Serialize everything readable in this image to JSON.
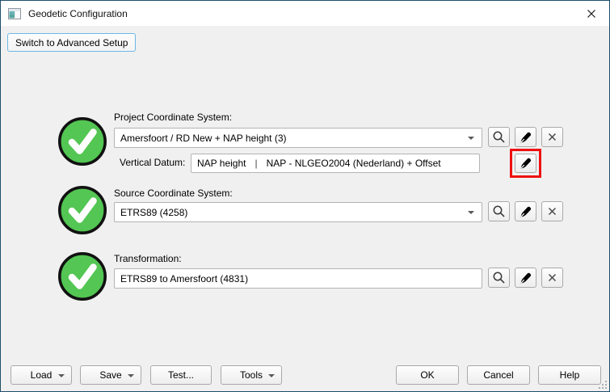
{
  "window": {
    "title": "Geodetic Configuration"
  },
  "buttons": {
    "switch_advanced": "Switch to Advanced Setup"
  },
  "sections": {
    "project": {
      "label": "Project Coordinate System:",
      "value": "Amersfoort / RD New + NAP height (3)",
      "status": "valid"
    },
    "vertical_datum": {
      "label": "Vertical Datum:",
      "primary": "NAP height",
      "separator": "|",
      "secondary": "NAP - NLGEO2004 (Nederland) + Offset",
      "edit_highlighted": true
    },
    "source": {
      "label": "Source Coordinate System:",
      "value": "ETRS89 (4258)",
      "status": "valid"
    },
    "transformation": {
      "label": "Transformation:",
      "value": "ETRS89 to Amersfoort (4831)",
      "status": "valid"
    }
  },
  "footer": {
    "load": "Load",
    "save": "Save",
    "test": "Test...",
    "tools": "Tools",
    "ok": "OK",
    "cancel": "Cancel",
    "help": "Help"
  },
  "icons": {
    "search": "magnifier",
    "edit": "black-pen",
    "clear": "x-cross",
    "dropdown": "down-triangle",
    "close": "x-cross",
    "status": "green-check-circle",
    "resize": "corner-grip-dots",
    "app": "window-glyph"
  },
  "colors": {
    "window_border": "#1f4e69",
    "body_bg": "#f0f0f0",
    "titlebar_bg": "#ffffff",
    "check_green": "#53c653",
    "check_outline": "#111111",
    "highlight_red": "#ee1111",
    "focus_blue": "#6cb8e6",
    "control_border": "#a9a9a9"
  }
}
